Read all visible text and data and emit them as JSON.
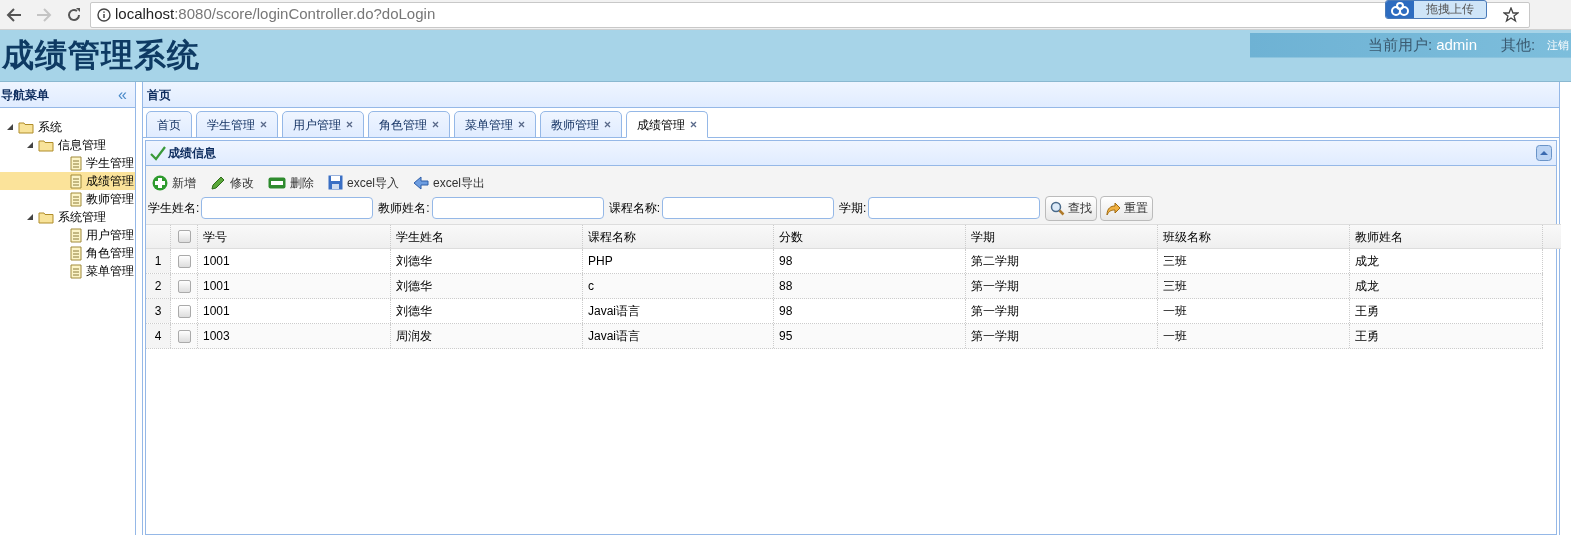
{
  "browser": {
    "url_host": "localhost",
    "url_path": ":8080/score/loginController.do?doLogin",
    "extension": "拖拽上传"
  },
  "header": {
    "title": "成绩管理系统",
    "user_label": "当前用户:",
    "user": "admin",
    "other_label": "其他:",
    "logout": "注销"
  },
  "nav": {
    "title": "导航菜单",
    "collapse": "«",
    "tree": [
      {
        "label": "系统",
        "kind": "folder",
        "expanded": true,
        "selected": false,
        "children": [
          {
            "label": "信息管理",
            "kind": "folder",
            "expanded": true,
            "selected": false,
            "children": [
              {
                "label": "学生管理",
                "kind": "file",
                "selected": false
              },
              {
                "label": "成绩管理",
                "kind": "file",
                "selected": true
              },
              {
                "label": "教师管理",
                "kind": "file",
                "selected": false
              }
            ]
          },
          {
            "label": "系统管理",
            "kind": "folder",
            "expanded": true,
            "selected": false,
            "children": [
              {
                "label": "用户管理",
                "kind": "file",
                "selected": false
              },
              {
                "label": "角色管理",
                "kind": "file",
                "selected": false
              },
              {
                "label": "菜单管理",
                "kind": "file",
                "selected": false
              }
            ]
          }
        ]
      }
    ]
  },
  "main": {
    "breadcrumb": "首页",
    "tabs": [
      {
        "label": "首页",
        "closable": false,
        "selected": false
      },
      {
        "label": "学生管理",
        "closable": true,
        "selected": false
      },
      {
        "label": "用户管理",
        "closable": true,
        "selected": false
      },
      {
        "label": "角色管理",
        "closable": true,
        "selected": false
      },
      {
        "label": "菜单管理",
        "closable": true,
        "selected": false
      },
      {
        "label": "教师管理",
        "closable": true,
        "selected": false
      },
      {
        "label": "成绩管理",
        "closable": true,
        "selected": true
      }
    ],
    "panel_title": "成绩信息",
    "toolbar": [
      {
        "label": "新增",
        "kind": "add"
      },
      {
        "label": "修改",
        "kind": "edit"
      },
      {
        "label": "删除",
        "kind": "remove"
      },
      {
        "label": "excel导入",
        "kind": "save"
      },
      {
        "label": "excel导出",
        "kind": "back"
      }
    ],
    "search_fields": [
      {
        "label": "学生姓名:"
      },
      {
        "label": "教师姓名:"
      },
      {
        "label": "课程名称:"
      },
      {
        "label": "学期:"
      }
    ],
    "search_buttons": [
      {
        "label": "查找",
        "kind": "search"
      },
      {
        "label": "重置",
        "kind": "redo"
      }
    ],
    "table": {
      "select_all": {
        "checked": false
      },
      "columns": [
        "学号",
        "学生姓名",
        "课程名称",
        "分数",
        "学期",
        "班级名称",
        "教师姓名"
      ],
      "rows": [
        {
          "number": "1",
          "checked": false,
          "cells": [
            "1001",
            "刘德华",
            "PHP",
            "98",
            "第二学期",
            "三班",
            "成龙"
          ]
        },
        {
          "number": "2",
          "checked": false,
          "cells": [
            "1001",
            "刘德华",
            "c",
            "88",
            "第一学期",
            "三班",
            "成龙"
          ]
        },
        {
          "number": "3",
          "checked": false,
          "cells": [
            "1001",
            "刘德华",
            "Javai语言",
            "98",
            "第一学期",
            "一班",
            "王勇"
          ]
        },
        {
          "number": "4",
          "checked": false,
          "cells": [
            "1003",
            "周润发",
            "Javai语言",
            "95",
            "第一学期",
            "一班",
            "王勇"
          ]
        }
      ]
    }
  }
}
